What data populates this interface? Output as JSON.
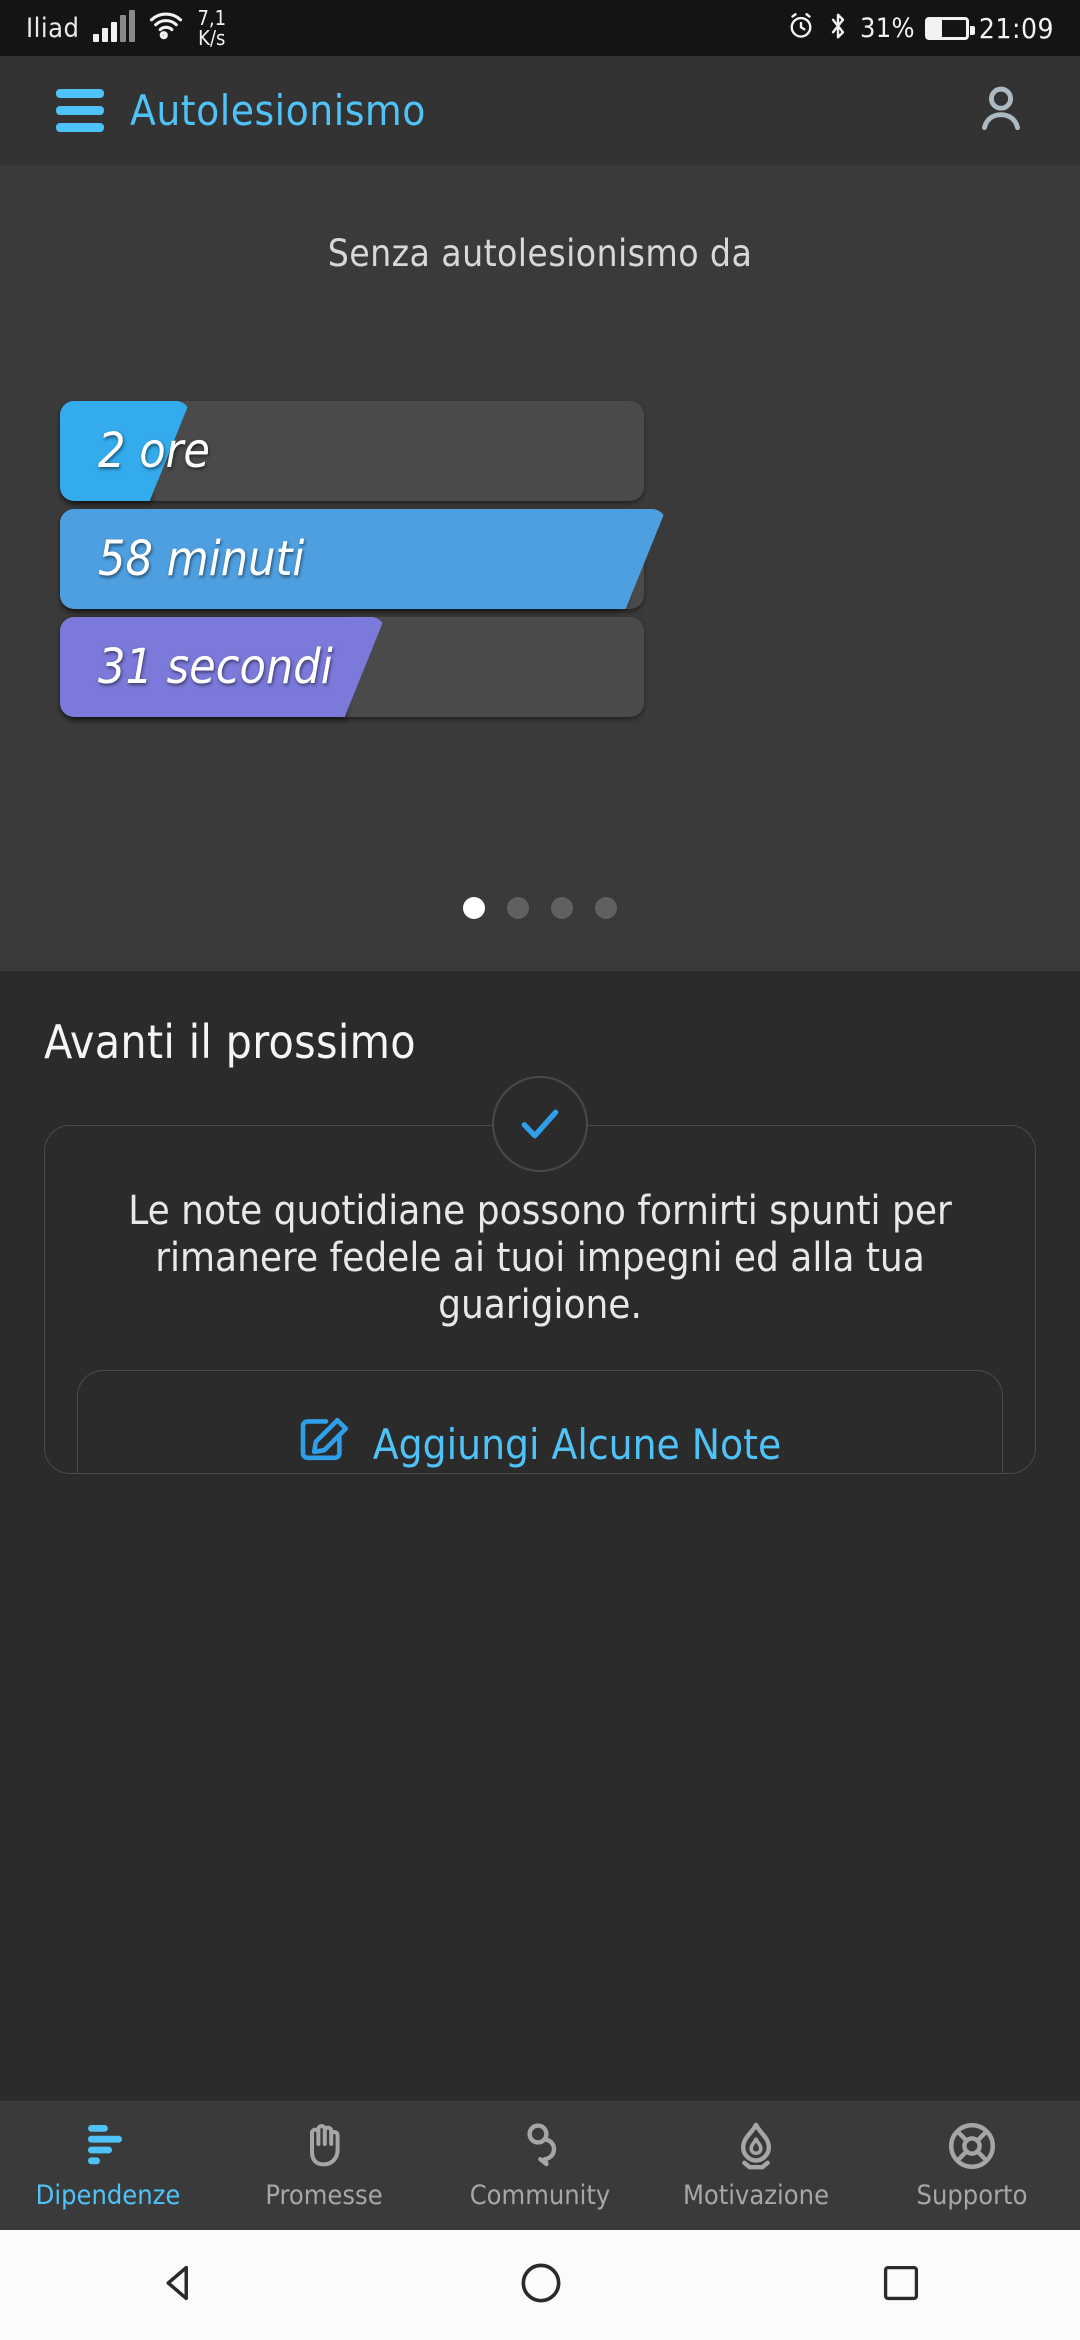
{
  "statusbar": {
    "carrier": "Iliad",
    "signal_icon": "signal-bars-icon",
    "wifi_icon": "wifi-icon",
    "network_speed_value": "7,1",
    "network_speed_unit": "K/s",
    "alarm_icon": "alarm-clock-icon",
    "bluetooth_icon": "bluetooth-icon",
    "battery_percent": "31%",
    "battery_icon": "battery-icon",
    "clock": "21:09"
  },
  "appbar": {
    "menu_icon": "hamburger-menu-icon",
    "title": "Autolesionismo",
    "account_icon": "account-person-icon"
  },
  "timer": {
    "caption": "Senza autolesionismo da",
    "bars": [
      {
        "value": "2",
        "unit": "ore",
        "percent": 8,
        "color": "#34ABEC"
      },
      {
        "value": "58",
        "unit": "minuti",
        "percent": 97,
        "color": "#4E9FE0"
      },
      {
        "value": "31",
        "unit": "secondi",
        "percent": 52,
        "color": "#7B79D9"
      }
    ],
    "pager": {
      "count": 4,
      "active_index": 0
    }
  },
  "next_up": {
    "title": "Avanti il prossimo",
    "check_icon": "check-circle-icon",
    "card_text": "Le note quotidiane possono fornirti spunti per rimanere fedele ai tuoi impegni ed alla tua guarigione.",
    "action": {
      "icon": "edit-note-icon",
      "label": "Aggiungi Alcune Note",
      "color": "#2E9FE8"
    }
  },
  "bottom_nav": {
    "active_color": "#4FC3F7",
    "inactive_color": "#A6A6A6",
    "items": [
      {
        "label": "Dipendenze",
        "icon": "bar-chart-icon",
        "active": true
      },
      {
        "label": "Promesse",
        "icon": "hand-icon",
        "active": false
      },
      {
        "label": "Community",
        "icon": "person-chat-icon",
        "active": false
      },
      {
        "label": "Motivazione",
        "icon": "flame-icon",
        "active": false
      },
      {
        "label": "Supporto",
        "icon": "life-ring-icon",
        "active": false
      }
    ]
  },
  "system_nav": {
    "back_icon": "back-triangle-icon",
    "home_icon": "home-circle-icon",
    "recents_icon": "recents-square-icon"
  }
}
